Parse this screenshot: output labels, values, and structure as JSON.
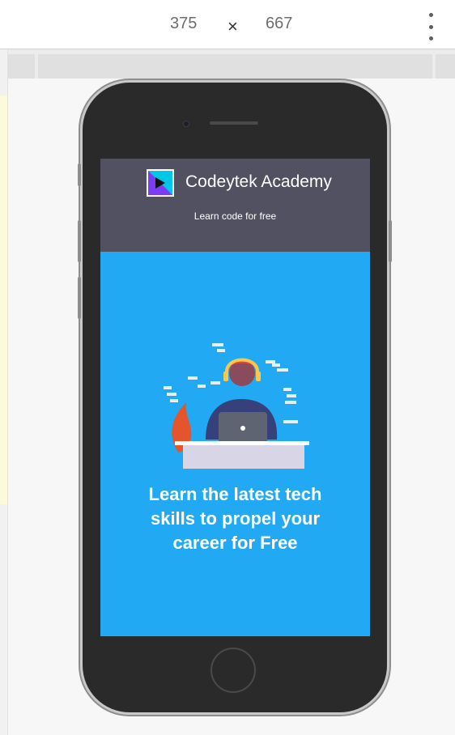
{
  "toolbar": {
    "width_value": "375",
    "times_symbol": "×",
    "height_value": "667",
    "more_icon": "vertical-ellipsis"
  },
  "app": {
    "title": "Codeytek Academy",
    "subtitle": "Learn code for free",
    "logo_icon": "codeytek-logo"
  },
  "hero": {
    "headline_lines": [
      "Learn the latest tech",
      "skills to propel your",
      "career for Free"
    ],
    "illustration": "developer-at-laptop"
  },
  "colors": {
    "header_bg": "#525161",
    "hero_bg": "#21aaf3",
    "phone_body": "#2a2a2a"
  }
}
